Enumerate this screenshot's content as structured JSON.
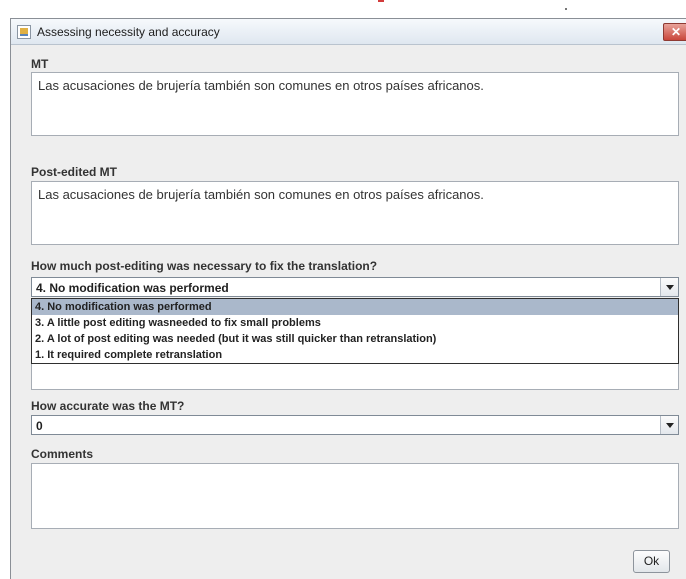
{
  "window": {
    "title": "Assessing necessity and accuracy",
    "close_icon": "close-icon",
    "app_icon": "java-app-icon"
  },
  "mt": {
    "label": "MT",
    "text": "Las acusaciones de brujería también son comunes en otros países africanos."
  },
  "post_edited": {
    "label": "Post-edited MT",
    "text": "Las acusaciones de brujería también son comunes en otros países africanos."
  },
  "necessity": {
    "question": "How much post-editing was necessary to fix the translation?",
    "selected": "4. No modification was performed",
    "options": [
      "4. No modification was performed",
      "3. A little post editing wasneeded to fix small problems",
      "2. A lot of post editing was needed (but it was still quicker than retranslation)",
      "1. It required complete retranslation"
    ]
  },
  "accuracy": {
    "question": "How accurate was the MT?",
    "selected": "0"
  },
  "comments": {
    "label": "Comments",
    "value": ""
  },
  "ok_label": "Ok"
}
